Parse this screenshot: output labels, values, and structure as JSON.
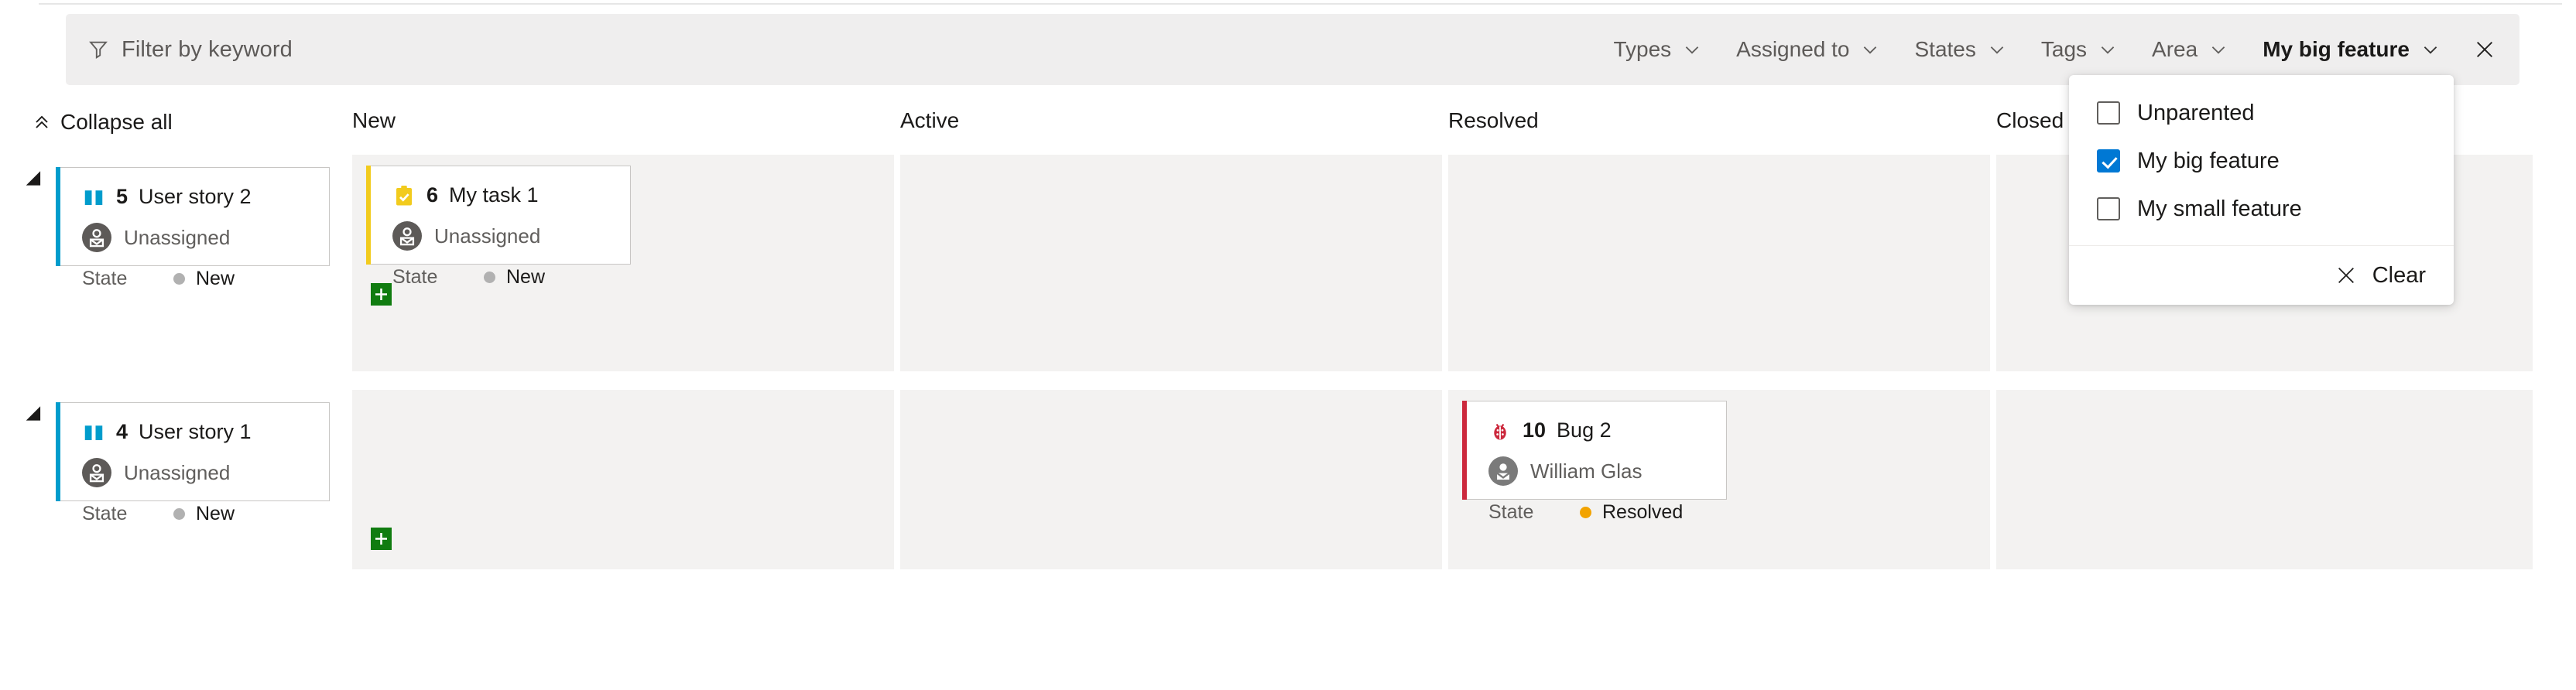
{
  "filter_bar": {
    "keyword_placeholder": "Filter by keyword",
    "funnel_icon": "funnel-icon",
    "close_icon": "close-icon",
    "pills": [
      {
        "label": "Types",
        "selected": false
      },
      {
        "label": "Assigned to",
        "selected": false
      },
      {
        "label": "States",
        "selected": false
      },
      {
        "label": "Tags",
        "selected": false
      },
      {
        "label": "Area",
        "selected": false
      },
      {
        "label": "My big feature",
        "selected": true
      }
    ]
  },
  "dropdown": {
    "open_for": "My big feature",
    "items": [
      {
        "label": "Unparented",
        "checked": false
      },
      {
        "label": "My big feature",
        "checked": true
      },
      {
        "label": "My small feature",
        "checked": false
      }
    ],
    "clear_label": "Clear",
    "clear_icon": "close-icon",
    "checked_color": "#0078d4"
  },
  "board": {
    "collapse_all_label": "Collapse all",
    "collapse_all_icon": "chevron-double-up-icon",
    "columns": [
      "New",
      "Active",
      "Resolved",
      "Closed"
    ],
    "add_button_color": "#107c10",
    "rows": [
      {
        "parent": {
          "id": "5",
          "title": "User story 2",
          "type": "User Story",
          "type_icon": "book-icon",
          "accent": "#009ccc",
          "assignee": "Unassigned",
          "avatar_icon": "unassigned-avatar-icon",
          "field_label": "State",
          "state": "New",
          "state_color": "#b1b1b1"
        },
        "cards": {
          "New": [
            {
              "id": "6",
              "title": "My task 1",
              "type": "Task",
              "type_icon": "task-clipboard-icon",
              "accent": "#f2cb1d",
              "assignee": "Unassigned",
              "avatar_icon": "unassigned-avatar-icon",
              "field_label": "State",
              "state": "New",
              "state_color": "#b1b1b1"
            }
          ],
          "Active": [],
          "Resolved": [],
          "Closed": []
        }
      },
      {
        "parent": {
          "id": "4",
          "title": "User story 1",
          "type": "User Story",
          "type_icon": "book-icon",
          "accent": "#009ccc",
          "assignee": "Unassigned",
          "avatar_icon": "unassigned-avatar-icon",
          "field_label": "State",
          "state": "New",
          "state_color": "#b1b1b1"
        },
        "cards": {
          "New": [],
          "Active": [],
          "Resolved": [
            {
              "id": "10",
              "title": "Bug 2",
              "type": "Bug",
              "type_icon": "bug-icon",
              "accent": "#cc293d",
              "assignee": "William Glas",
              "avatar_icon": "user-avatar-icon",
              "field_label": "State",
              "state": "Resolved",
              "state_color": "#f2a300"
            }
          ],
          "Closed": []
        }
      }
    ]
  }
}
